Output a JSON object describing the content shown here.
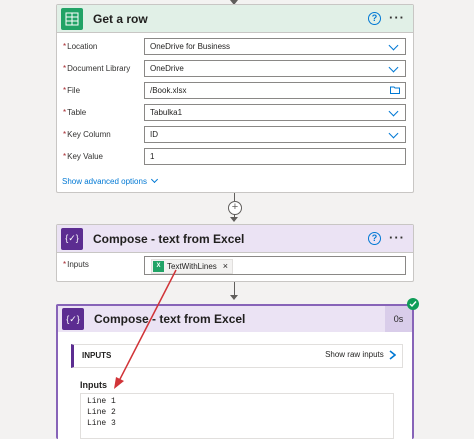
{
  "card1": {
    "title": "Get a row",
    "fields": [
      {
        "label": "Location",
        "value": "OneDrive for Business",
        "control": "dropdown"
      },
      {
        "label": "Document Library",
        "value": "OneDrive",
        "control": "dropdown"
      },
      {
        "label": "File",
        "value": "/Book.xlsx",
        "control": "file-picker"
      },
      {
        "label": "Table",
        "value": "Tabulka1",
        "control": "dropdown"
      },
      {
        "label": "Key Column",
        "value": "ID",
        "control": "dropdown"
      },
      {
        "label": "Key Value",
        "value": "1",
        "control": "text"
      }
    ],
    "advanced": "Show advanced options"
  },
  "card2": {
    "title": "Compose - text from Excel",
    "inputs_label": "Inputs",
    "token": "TextWithLines"
  },
  "card3": {
    "title": "Compose - text from Excel",
    "duration": "0s",
    "section_title": "INPUTS",
    "raw_link": "Show raw inputs",
    "inputs_heading": "Inputs",
    "lines": [
      "Line 1",
      "Line 2",
      "Line 3"
    ]
  },
  "colors": {
    "excel_green": "#21a366",
    "compose_purple": "#5c2d91",
    "success": "#0f9d58",
    "annotation_red": "#d13438"
  }
}
